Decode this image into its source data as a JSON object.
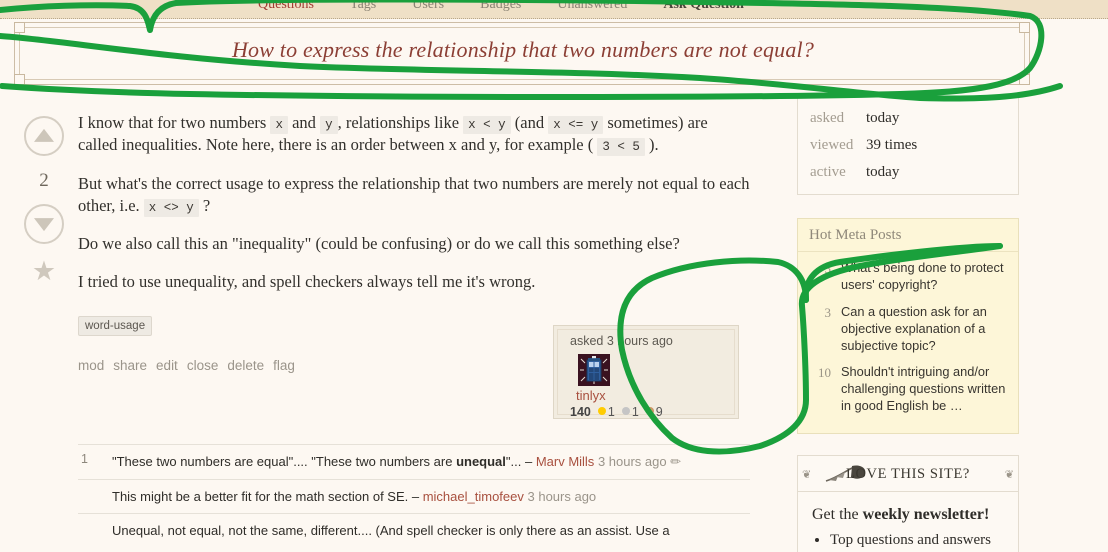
{
  "nav": {
    "items": [
      {
        "label": "Questions",
        "state": "active"
      },
      {
        "label": "Tags",
        "state": "normal"
      },
      {
        "label": "Users",
        "state": "normal"
      },
      {
        "label": "Badges",
        "state": "normal"
      },
      {
        "label": "Unanswered",
        "state": "normal"
      },
      {
        "label": "Ask Question",
        "state": "bold"
      }
    ]
  },
  "question": {
    "title": "How to express the relationship that two numbers are not equal?",
    "votes": "2",
    "body": {
      "p1_a": "I know that for two numbers ",
      "p1_code1": "x",
      "p1_b": " and ",
      "p1_code2": "y",
      "p1_c": ", relationships like ",
      "p1_code3": "x < y",
      "p1_d": " (and ",
      "p1_code4": "x <= y",
      "p1_e": " sometimes) are called inequalities. Note here, there is an order between x and y, for example ( ",
      "p1_code5": "3 < 5",
      "p1_f": " ).",
      "p2_a": "But what's the correct usage to express the relationship that two numbers are merely not equal to each other, i.e. ",
      "p2_code1": "x <> y",
      "p2_b": " ?",
      "p3": "Do we also call this an \"inequality\" (could be confusing) or do we call this something else?",
      "p4": "I tried to use unequality, and spell checkers always tell me it's wrong."
    },
    "tags": [
      "word-usage"
    ],
    "actions": [
      "mod",
      "share",
      "edit",
      "close",
      "delete",
      "flag"
    ]
  },
  "usercard": {
    "time_label": "asked 3 hours ago",
    "username": "tinlyx",
    "reputation": "140",
    "gold": "1",
    "silver": "1",
    "bronze": "9"
  },
  "comments": [
    {
      "score": "1",
      "text_before": "\"These two numbers are equal\".... \"These two numbers are ",
      "text_bold": "unequal",
      "text_after": "\"... – ",
      "user": "Marv Mills",
      "time": "3 hours ago",
      "edit_icon": "pencil-icon"
    },
    {
      "score": "",
      "text_before": "This might be a better fit for the math section of SE. – ",
      "text_bold": "",
      "text_after": "",
      "user": "michael_timofeev",
      "time": "3 hours ago",
      "edit_icon": ""
    },
    {
      "score": "",
      "text_before": "Unequal, not equal, not the same, different.... (And spell checker is only there as an assist. Use a",
      "text_bold": "",
      "text_after": "",
      "user": "",
      "time": "",
      "edit_icon": ""
    }
  ],
  "sidebar": {
    "stats": [
      {
        "label": "asked",
        "value": "today"
      },
      {
        "label": "viewed",
        "value": "39 times"
      },
      {
        "label": "active",
        "value": "today"
      }
    ],
    "hot_meta": {
      "heading": "Hot Meta Posts",
      "items": [
        {
          "score": "5",
          "title": "What's being done to protect users' copyright?"
        },
        {
          "score": "3",
          "title": "Can a question ask for an objective explanation of a subjective topic?"
        },
        {
          "score": "10",
          "title": "Shouldn't intriguing and/or challenging questions written in good English be …"
        }
      ]
    },
    "newsletter": {
      "heading": "LOVE THIS SITE?",
      "lead_a": "Get the ",
      "lead_b": "weekly newsletter!",
      "bullets": [
        "Top questions and answers"
      ]
    }
  },
  "colors": {
    "accent_link": "#a8503f",
    "title": "#8c3f35",
    "nav_bg": "#efe0c6",
    "page_bg": "#fdf8f2",
    "annotation_ink": "#1aa03c",
    "hot_panel_bg": "#fdf6d8"
  },
  "annotation": {
    "tool": "green-marker",
    "shapes": [
      "loop-around-title",
      "loop-around-user-card"
    ]
  }
}
